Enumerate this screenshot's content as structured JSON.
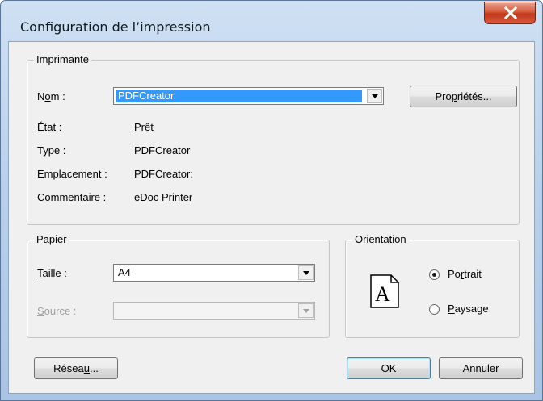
{
  "window": {
    "title": "Configuration de l’impression",
    "close_icon": "close-icon"
  },
  "printer": {
    "group_label": "Imprimante",
    "name_label_prefix": "N",
    "name_label_accel": "o",
    "name_label_suffix": "m :",
    "name_value": "PDFCreator",
    "properties_prefix": "Pro",
    "properties_accel": "p",
    "properties_suffix": "riétés...",
    "status_label": "État :",
    "status_value": "Prêt",
    "type_label": "Type :",
    "type_value": "PDFCreator",
    "location_label": "Emplacement :",
    "location_value": "PDFCreator:",
    "comment_label": "Commentaire :",
    "comment_value": "eDoc Printer"
  },
  "paper": {
    "group_label": "Papier",
    "size_label_accel": "T",
    "size_label_suffix": "aille :",
    "size_value": "A4",
    "source_label_accel": "S",
    "source_label_suffix": "ource :",
    "source_value": ""
  },
  "orientation": {
    "group_label": "Orientation",
    "icon_glyph": "A",
    "portrait_prefix": "Po",
    "portrait_accel": "r",
    "portrait_suffix": "trait",
    "landscape_accel": "P",
    "landscape_suffix": "aysage",
    "selected": "portrait"
  },
  "buttons": {
    "network_prefix": "Résea",
    "network_accel": "u",
    "network_suffix": "...",
    "ok": "OK",
    "cancel": "Annuler"
  }
}
